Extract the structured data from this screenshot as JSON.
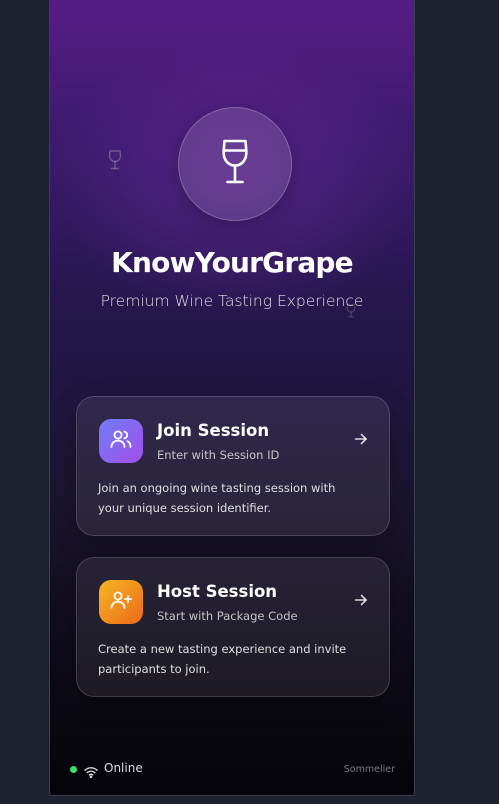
{
  "app": {
    "title": "KnowYourGrape",
    "subtitle": "Premium Wine Tasting Experience",
    "logo_icon": "wine-glass-icon"
  },
  "cards": {
    "join": {
      "title": "Join Session",
      "subtitle": "Enter with Session ID",
      "description": "Join an ongoing wine tasting session with your unique session identifier.",
      "icon": "users-icon",
      "icon_gradient": [
        "#6f7df6",
        "#a24fe9"
      ]
    },
    "host": {
      "title": "Host Session",
      "subtitle": "Start with Package Code",
      "description": "Create a new tasting experience and invite participants to join.",
      "icon": "user-plus-icon",
      "icon_gradient": [
        "#f6b523",
        "#ec6a1b"
      ]
    }
  },
  "status": {
    "connection": "Online",
    "role": "Sommelier",
    "online_color": "#3ee06b"
  },
  "colors": {
    "background": "#1e2230",
    "accent_purple": "#551c86"
  }
}
